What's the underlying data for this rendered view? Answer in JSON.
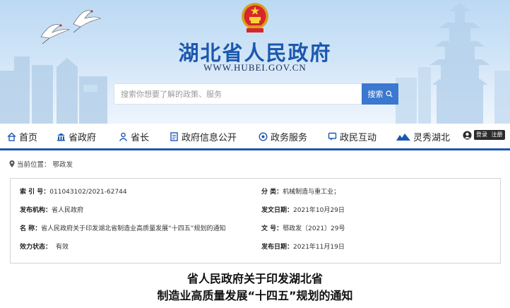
{
  "header": {
    "site_title": "湖北省人民政府",
    "site_url": "WWW.HUBEI.GOV.CN",
    "search_placeholder": "搜索你想要了解的政策、服务",
    "search_button": "搜索"
  },
  "nav": {
    "items": [
      {
        "label": "首页",
        "icon": "home-icon"
      },
      {
        "label": "省政府",
        "icon": "building-icon"
      },
      {
        "label": "省长",
        "icon": "person-icon"
      },
      {
        "label": "政府信息公开",
        "icon": "document-icon"
      },
      {
        "label": "政务服务",
        "icon": "service-icon"
      },
      {
        "label": "政民互动",
        "icon": "chat-icon"
      },
      {
        "label": "灵秀湖北",
        "icon": "landscape-icon"
      }
    ],
    "login_label": "登录",
    "register_label": "注册"
  },
  "breadcrumb": {
    "prefix": "当前位置：",
    "current": "鄂政发"
  },
  "info": {
    "index_label": "索 引 号：",
    "index_value": "011043102/2021-62744",
    "category_label": "分 类：",
    "category_value": "机械制造与重工业；",
    "publisher_label": "发布机构：",
    "publisher_value": "省人民政府",
    "issue_date_label": "发文日期：",
    "issue_date_value": "2021年10月29日",
    "name_label": "名 称：",
    "name_value": "省人民政府关于印发湖北省制造业高质量发展“十四五”规划的通知",
    "doc_no_label": "文 号：",
    "doc_no_value": "鄂政发〔2021〕29号",
    "status_label": "效力状态：",
    "status_value": "有效",
    "publish_date_label": "发布日期：",
    "publish_date_value": "2021年11月19日"
  },
  "article": {
    "title_line1": "省人民政府关于印发湖北省",
    "title_line2": "制造业高质量发展“十四五”规划的通知"
  },
  "colors": {
    "brand_blue": "#1c58b0",
    "search_button": "#3b78cf"
  }
}
